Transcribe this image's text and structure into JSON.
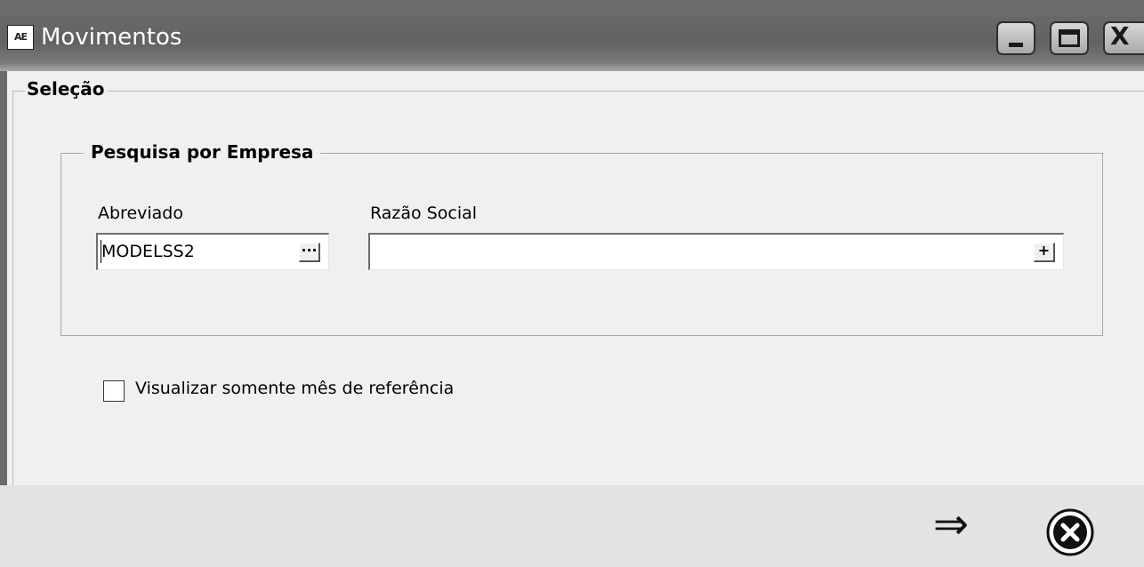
{
  "window": {
    "app_icon_text": "AE",
    "title": "Movimentos",
    "buttons": {
      "minimize": "minimize-icon",
      "maximize": "maximize-icon",
      "close": "close-icon"
    }
  },
  "selection_group": {
    "label": "Seleção"
  },
  "company_search": {
    "label": "Pesquisa por Empresa",
    "abreviado": {
      "label": "Abreviado",
      "value": "MODELSS2",
      "lookup_button": "···"
    },
    "razao_social": {
      "label": "Razão Social",
      "value": "",
      "add_button": "+"
    }
  },
  "reference_month": {
    "label": "Visualizar somente mês de referência",
    "checked": false
  },
  "footer": {
    "confirm_icon": "arrow-right-icon",
    "cancel_icon": "cancel-circle-icon"
  }
}
